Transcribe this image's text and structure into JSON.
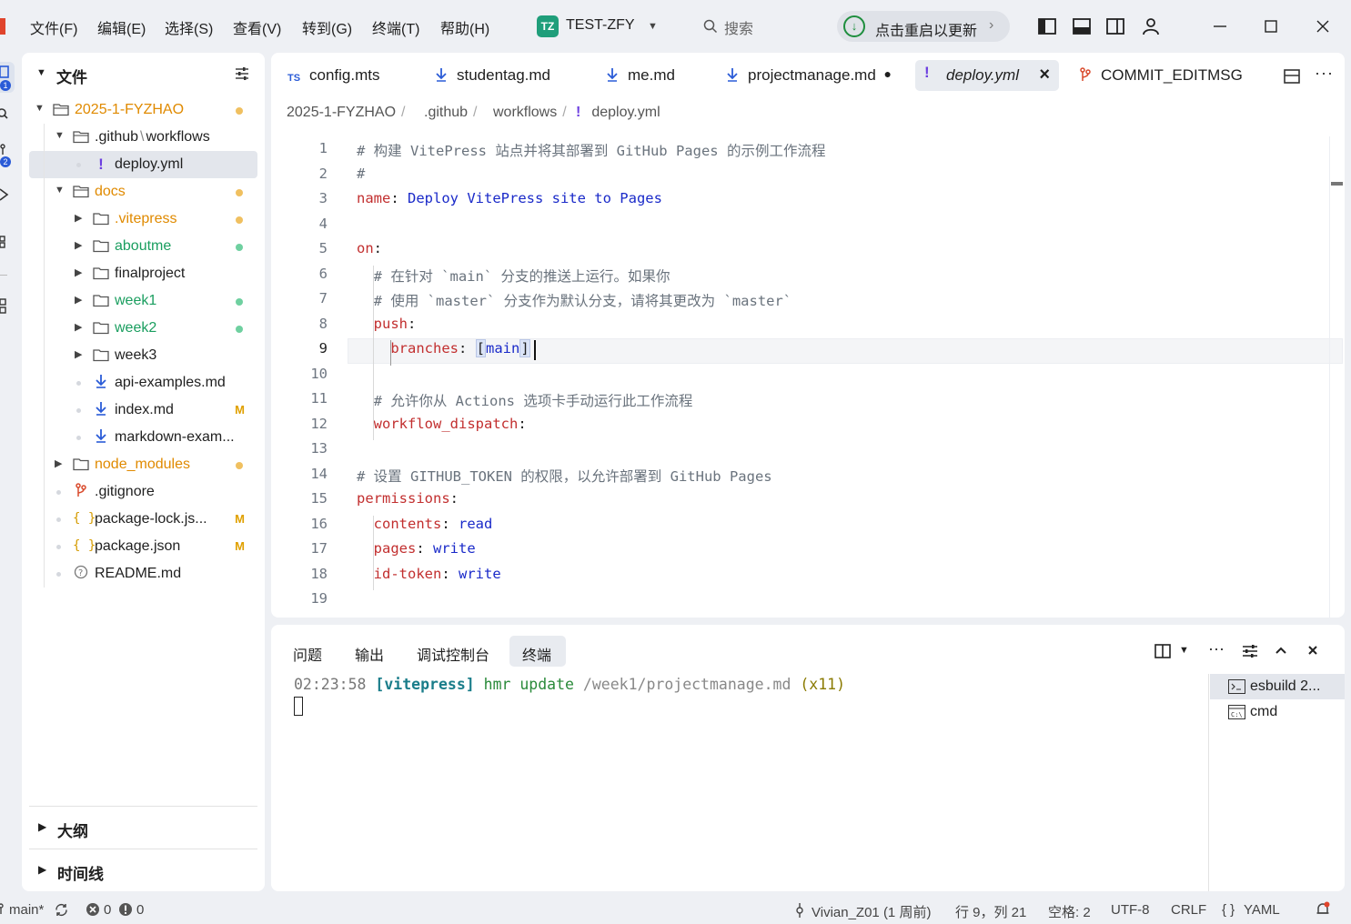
{
  "menu": [
    "文件(F)",
    "编辑(E)",
    "选择(S)",
    "查看(V)",
    "转到(G)",
    "终端(T)",
    "帮助(H)"
  ],
  "workspace": {
    "badge": "TZ",
    "name": "TEST-ZFY"
  },
  "search": {
    "label": "搜索"
  },
  "update": {
    "label": "点击重启以更新"
  },
  "activity_badges": [
    "1",
    "2"
  ],
  "sidebar": {
    "title": "文件",
    "tree": [
      {
        "label": "2025-1-FYZHAO",
        "kind": "folder-open",
        "status": "dot-orange"
      },
      {
        "label": ".github",
        "label2": "workflows",
        "kind": "folder-open"
      },
      {
        "label": "deploy.yml",
        "kind": "yaml",
        "selected": true
      },
      {
        "label": "docs",
        "kind": "folder-open",
        "status": "dot-orange"
      },
      {
        "label": ".vitepress",
        "kind": "folder",
        "status": "dot-orange"
      },
      {
        "label": "aboutme",
        "kind": "folder",
        "status": "dot-green"
      },
      {
        "label": "finalproject",
        "kind": "folder"
      },
      {
        "label": "week1",
        "kind": "folder",
        "status": "dot-green"
      },
      {
        "label": "week2",
        "kind": "folder",
        "status": "dot-green"
      },
      {
        "label": "week3",
        "kind": "folder"
      },
      {
        "label": "api-examples.md",
        "kind": "md"
      },
      {
        "label": "index.md",
        "kind": "md",
        "status": "M"
      },
      {
        "label": "markdown-exam...",
        "kind": "md"
      },
      {
        "label": "node_modules",
        "kind": "folder",
        "status": "dot-orange"
      },
      {
        "label": ".gitignore",
        "kind": "git"
      },
      {
        "label": "package-lock.js...",
        "kind": "json",
        "status": "M"
      },
      {
        "label": "package.json",
        "kind": "json",
        "status": "M"
      },
      {
        "label": "README.md",
        "kind": "readme"
      }
    ],
    "outline": "大纲",
    "timeline": "时间线"
  },
  "tabs": [
    {
      "label": "config.mts",
      "icon": "TS"
    },
    {
      "label": "studentag.md",
      "icon": "md"
    },
    {
      "label": "me.md",
      "icon": "md"
    },
    {
      "label": "projectmanage.md",
      "icon": "md",
      "modified": "●"
    },
    {
      "label": "deploy.yml",
      "icon": "!",
      "active": true,
      "close": "×"
    },
    {
      "label": "COMMIT_EDITMSG",
      "icon": "git"
    }
  ],
  "breadcrumb": [
    "2025-1-FYZHAO",
    ".github",
    "workflows",
    "deploy.yml"
  ],
  "code": [
    "# 构建 VitePress 站点并将其部署到 GitHub Pages 的示例工作流程",
    "#",
    "name: Deploy VitePress site to Pages",
    "",
    "on:",
    "  # 在针对 `main` 分支的推送上运行。如果你",
    "  # 使用 `master` 分支作为默认分支，请将其更改为 `master`",
    "  push:",
    "    branches: [main]",
    "",
    "  # 允许你从 Actions 选项卡手动运行此工作流程",
    "  workflow_dispatch:",
    "",
    "# 设置 GITHUB_TOKEN 的权限，以允许部署到 GitHub Pages",
    "permissions:",
    "  contents: read",
    "  pages: write",
    "  id-token: write",
    ""
  ],
  "line_numbers": [
    "1",
    "2",
    "3",
    "4",
    "5",
    "6",
    "7",
    "8",
    "9",
    "10",
    "11",
    "12",
    "13",
    "14",
    "15",
    "16",
    "17",
    "18",
    "19"
  ],
  "panel": {
    "tabs": [
      "问题",
      "输出",
      "调试控制台",
      "终端"
    ],
    "terminal": {
      "time": "02:23:58",
      "tag": "[vitepress]",
      "msg": "hmr update",
      "path": "/week1/projectmanage.md",
      "count": "(x11)"
    },
    "terminals": [
      "esbuild 2...",
      "cmd"
    ]
  },
  "status": {
    "branch": "main*",
    "errors": "0",
    "warnings": "0",
    "blame": "Vivian_Z01 (1 周前)",
    "position": "行 9，列 21",
    "spaces": "空格: 2",
    "encoding": "UTF-8",
    "eol": "CRLF",
    "language": "YAML"
  },
  "colors": {
    "accent": "#1f9e7a",
    "modified": "#e08a00",
    "added": "#1a9e5f"
  }
}
